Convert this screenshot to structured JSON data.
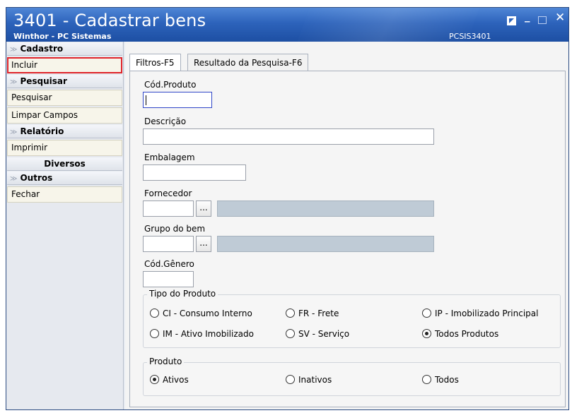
{
  "window": {
    "title": "3401 - Cadastrar bens",
    "subtitle": "Winthor - PC Sistemas",
    "code": "PCSIS3401",
    "controls": {
      "minimize": "_",
      "close": "✕"
    }
  },
  "sidebar": {
    "sections": [
      {
        "label": "Cadastro",
        "items": [
          {
            "label": "Incluir",
            "highlighted": true
          }
        ]
      },
      {
        "label": "Pesquisar",
        "items": [
          {
            "label": "Pesquisar"
          },
          {
            "label": "Limpar Campos"
          }
        ]
      },
      {
        "label": "Relatório",
        "items": [
          {
            "label": "Imprimir"
          }
        ]
      },
      {
        "label": "Diversos",
        "items": []
      },
      {
        "label": "Outros",
        "items": [
          {
            "label": "Fechar"
          }
        ]
      }
    ],
    "chevron": "≫"
  },
  "tabs": [
    {
      "label": "Filtros-F5",
      "active": true
    },
    {
      "label": "Resultado da Pesquisa-F6",
      "active": false
    }
  ],
  "form": {
    "cod_produto": {
      "label": "Cód.Produto",
      "value": ""
    },
    "descricao": {
      "label": "Descrição",
      "value": ""
    },
    "embalagem": {
      "label": "Embalagem",
      "value": ""
    },
    "fornecedor": {
      "label": "Fornecedor",
      "value": "",
      "browse": "..."
    },
    "grupo_bem": {
      "label": "Grupo do bem",
      "value": "",
      "browse": "..."
    },
    "cod_genero": {
      "label": "Cód.Gênero",
      "value": ""
    }
  },
  "tipo_produto": {
    "title": "Tipo do Produto",
    "options": [
      {
        "label": "CI - Consumo Interno",
        "selected": false
      },
      {
        "label": "FR - Frete",
        "selected": false
      },
      {
        "label": "IP - Imobilizado Principal",
        "selected": false
      },
      {
        "label": "IM - Ativo Imobilizado",
        "selected": false
      },
      {
        "label": "SV - Serviço",
        "selected": false
      },
      {
        "label": "Todos Produtos",
        "selected": true
      }
    ]
  },
  "produto": {
    "title": "Produto",
    "options": [
      {
        "label": "Ativos",
        "selected": true
      },
      {
        "label": "Inativos",
        "selected": false
      },
      {
        "label": "Todos",
        "selected": false
      }
    ]
  },
  "colors": {
    "titlebar": "#2d63bb",
    "highlight": "#e0242b",
    "focus_border": "#2f46c8",
    "readonly_field": "#bfcbd6"
  }
}
